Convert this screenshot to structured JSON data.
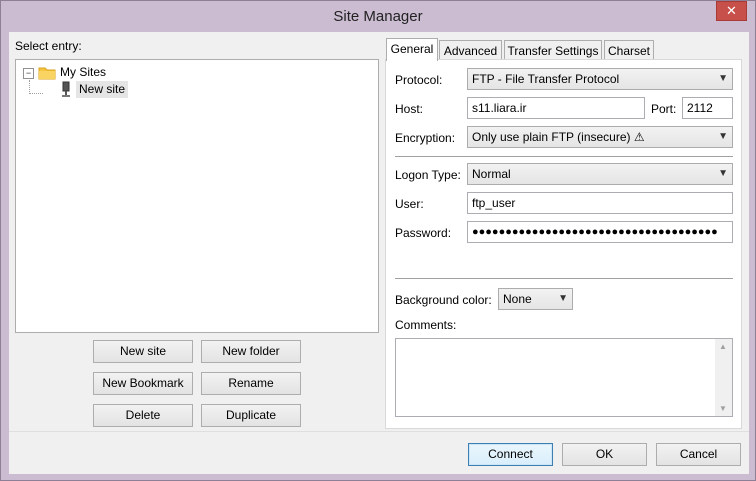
{
  "window": {
    "title": "Site Manager",
    "close_glyph": "✕"
  },
  "left": {
    "select_entry_label": "Select entry:",
    "tree": {
      "root": {
        "label": "My Sites",
        "expander": "⊟"
      },
      "child": {
        "label": "New site"
      }
    },
    "buttons": {
      "new_site": "New site",
      "new_folder": "New folder",
      "new_bookmark": "New Bookmark",
      "rename": "Rename",
      "delete": "Delete",
      "duplicate": "Duplicate"
    }
  },
  "tabs": [
    "General",
    "Advanced",
    "Transfer Settings",
    "Charset"
  ],
  "general": {
    "protocol_label": "Protocol:",
    "protocol_value": "FTP - File Transfer Protocol",
    "host_label": "Host:",
    "host_value": "s11.liara.ir",
    "port_label": "Port:",
    "port_value": "2112",
    "encryption_label": "Encryption:",
    "encryption_value": "Only use plain FTP (insecure) ⚠",
    "logon_type_label": "Logon Type:",
    "logon_type_value": "Normal",
    "user_label": "User:",
    "user_value": "ftp_user",
    "password_label": "Password:",
    "password_value": "●●●●●●●●●●●●●●●●●●●●●●●●●●●●●●●●●●●●●",
    "bg_color_label": "Background color:",
    "bg_color_value": "None",
    "comments_label": "Comments:",
    "comments_value": ""
  },
  "footer": {
    "connect": "Connect",
    "ok": "OK",
    "cancel": "Cancel"
  },
  "colors": {
    "window_frame": "#cbbcd2",
    "close_button": "#c7504a",
    "dialog_bg": "#f0f0f0"
  }
}
